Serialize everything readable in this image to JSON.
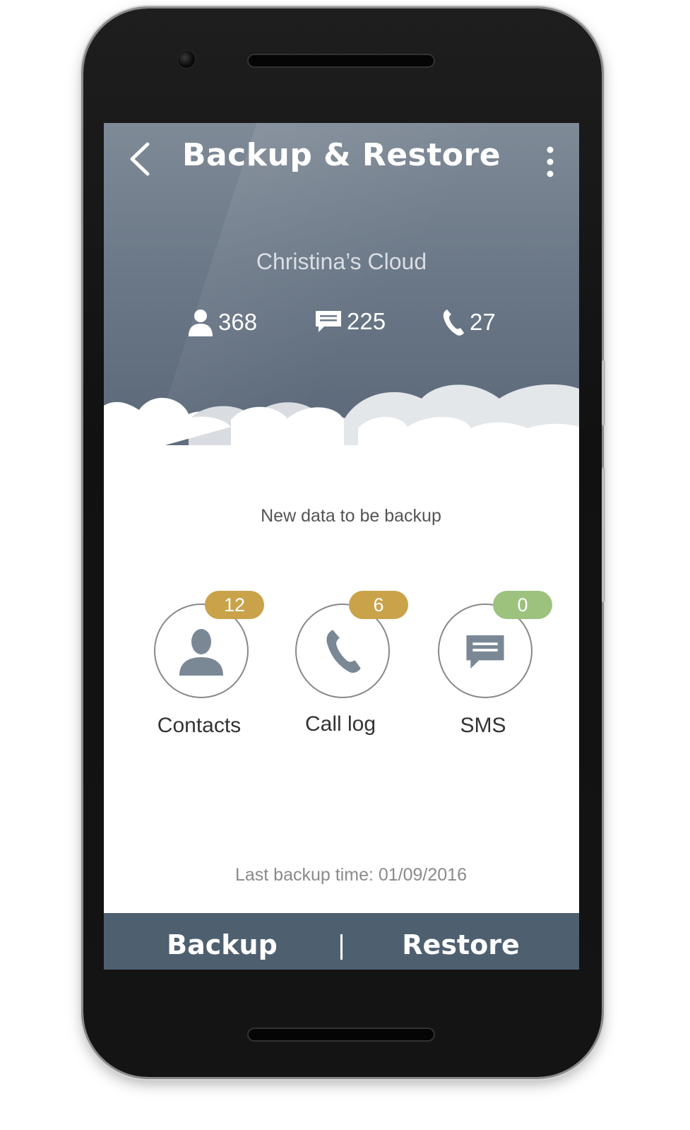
{
  "header": {
    "title": "Backup & Restore",
    "cloud_name": "Christina’s Cloud",
    "stats": {
      "contacts": "368",
      "messages": "225",
      "calls": "27"
    }
  },
  "main": {
    "new_data_label": "New data to be backup",
    "items": [
      {
        "label": "Contacts",
        "badge": "12",
        "badge_color": "#c9a24a",
        "icon": "person-icon"
      },
      {
        "label": "Call log",
        "badge": "6",
        "badge_color": "#c9a24a",
        "icon": "phone-icon"
      },
      {
        "label": "SMS",
        "badge": "0",
        "badge_color": "#9cc27e",
        "icon": "message-icon"
      }
    ],
    "last_backup": "Last backup time: 01/09/2016"
  },
  "bottom_bar": {
    "backup_label": "Backup",
    "restore_label": "Restore",
    "color": "#4e6070"
  }
}
